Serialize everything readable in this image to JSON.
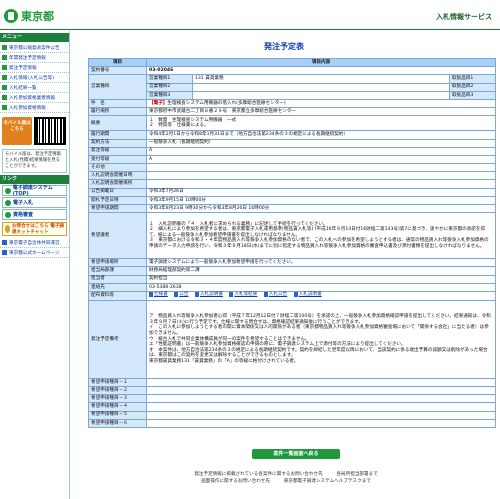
{
  "header": {
    "logo_text": "東京都",
    "system_name": "入札情報サービス"
  },
  "sidebar": {
    "menu_heading": "メニュー",
    "items": [
      {
        "label": "東京都公報発表案件公告",
        "icon": "arrow-icon"
      },
      {
        "label": "年間発注予定情報",
        "icon": "arrow-icon"
      },
      {
        "label": "発注予定情報",
        "icon": "arrow-icon"
      },
      {
        "label": "入札情報(入札公告等)",
        "icon": "arrow-icon"
      },
      {
        "label": "入札結果一覧",
        "icon": "arrow-icon"
      },
      {
        "label": "入札参加資格業者情報",
        "icon": "arrow-icon"
      },
      {
        "label": "入札参加資格情報",
        "icon": "arrow-icon"
      }
    ],
    "mobile_button": "モバイル版はこちら",
    "note": "モバイル版は、発注予定情報と入札(見積)結果情報を見ることができます。",
    "links_heading": "リンク",
    "links": [
      {
        "label": "電子調達システム(TOP)"
      },
      {
        "label": "電子入札"
      },
      {
        "label": "資格審査"
      }
    ],
    "eval_label": "お問合せはこちら 電子調達ネットチャット",
    "bottom_links": [
      "東京電子自治体共同運営",
      "東京都公式ホームページ"
    ]
  },
  "main": {
    "title": "発注予定表",
    "col_item": "項目",
    "col_content": "項目内容",
    "contract_no_label": "契約番号",
    "contract_no": "03-02046",
    "business_type_label": "営業種目",
    "business_rows": [
      {
        "k": "営業種目1",
        "v": "131 賃貸業務",
        "s": "取扱品目1",
        "sv": ""
      },
      {
        "k": "営業種目2",
        "v": "",
        "s": "取扱品目2",
        "sv": ""
      },
      {
        "k": "営業種目3",
        "v": "",
        "s": "取扱品目3",
        "sv": ""
      }
    ],
    "subject_label": "件　名",
    "subject_tag": "【電子】",
    "subject": "生理検査システム用機器の借入れ(多摩総合医療センター)",
    "place_label": "履行場所",
    "place": "東京都府中市武蔵台二丁目８番２９号　東京都立多摩総合医療センター",
    "summary_label": "概要",
    "summary": "１　数量　生理検査システム用機器　一式\n２　特質等　仕様書による。",
    "period_label": "履行期間",
    "period": "令和4年2月1日から令和8年1月31日まで（地方自治法第234条の３の規定による長期継続契約）",
    "method_label": "契約方法",
    "method": "一般競争入札（長期継続契約）",
    "rank_label": "発注等級",
    "rank": "A",
    "receive_rank_label": "受付等級",
    "receive_rank": "A",
    "other_label": "その他",
    "other": "",
    "briefing_date_label": "入札説明会開催日時",
    "briefing_date": "",
    "briefing_place_label": "入札説明会開催場所",
    "briefing_place": "",
    "announce_label": "公告掲載日",
    "announce": "令和3年7月26日",
    "open_label": "開札予定日時",
    "open": "令和3年9月15日 10時00分",
    "apply_period_label": "希望申請期間",
    "apply_period": "令和3年8月23日 9時30分から令和3年8月26日 16時00分",
    "conditions_label": "希望議者",
    "conditions": "１　入札説明書の「４　入札者に求められる義務」に記述して手続を行ってください。\n２　細入札により参加を希望する者は、東京都電子入札運用基準(物品賃入札等) (平成16年９月14日付16財経二第143号)第7に基づき、速やかに東京都の承諾を得て、紙による一般競争入札参加希望申請書を提出しなければなりません。\n３　東京都における令和３・４年度物品買入れ等競争入札参加資格のない者で、この入札への参加を希望しようとする者は、通常の物品買入れ等競争入札参加資格の申請のデータ入力申請を行い、令和３年８月18日(水)までに別に指定する物品買入れ等競争入札参加資格の審査申込書及び添付書類を提出しなければなりません。",
    "apply_place_label": "希望申請場所",
    "apply_place": "電子調達システムにより一般競争入札参加希望申請を行ってください。",
    "dept_label": "担当局部課",
    "dept": "財務局経理部契約第二課",
    "staff_label": "担当者",
    "staff": "契約担当",
    "tel_label": "連絡先",
    "tel": "03-5388-2638",
    "docs_label": "配布資料等",
    "docs": [
      "仕様書",
      "公告",
      "入札説明書",
      "入札等結果",
      "入札公告",
      "入札説明書"
    ],
    "notes_label": "発注予定備考",
    "notes": "ア　物品買入れ等競争入札参加者心得（平成７年12月12日付７財経二第100号）を承諾の上、一般競争入札参加資格確認申請を提出してください。結果通知は、令和３年９月７日(火)に行う予定です。仕様に関する問合せは、資格確認結果通知後に行うことができます。\nイ　この入札に参加しようとする者の間に資本関係又は人的関係がある者（東京都物品買入れ等競争入札参加資格審査場において「関係する会社」に当たる者）は参加できません。\nウ　紙台入札で共同企業体構成員が同一の案件を希望することはできません。\nエ「性能証明書」は一般競争入札参加資格確認の申請の際に、電子調達システム上で添付等の方法により提出してください。\nオ　本案件は、地方自治法第234条の３の規定による長期継続契約です。契約を締結した翌年度以降において、当該契約に係る歳出予算の減額又は削除があった場合は、東京都はこの契約を変更又は解除することができるものとします。\n東京都賃貸業務131「賃貸業務」の「A」の等級に格付けされている者。",
    "hope_labels": [
      "希望申請種目－１",
      "希望申請種目－２",
      "希望申請種目－３",
      "希望申請種目－４",
      "希望申請種目－５",
      "希望申請種目－６"
    ],
    "back_button": "案件一覧画面へ戻る",
    "footer1": "発注予定情報に掲載されている各案件に関するお問い合わせ先　　　各局所担当部署まで",
    "footer2": "画面操作に関するお問い合わせ先　　　東京都電子調達システムヘルプデスクまで"
  }
}
